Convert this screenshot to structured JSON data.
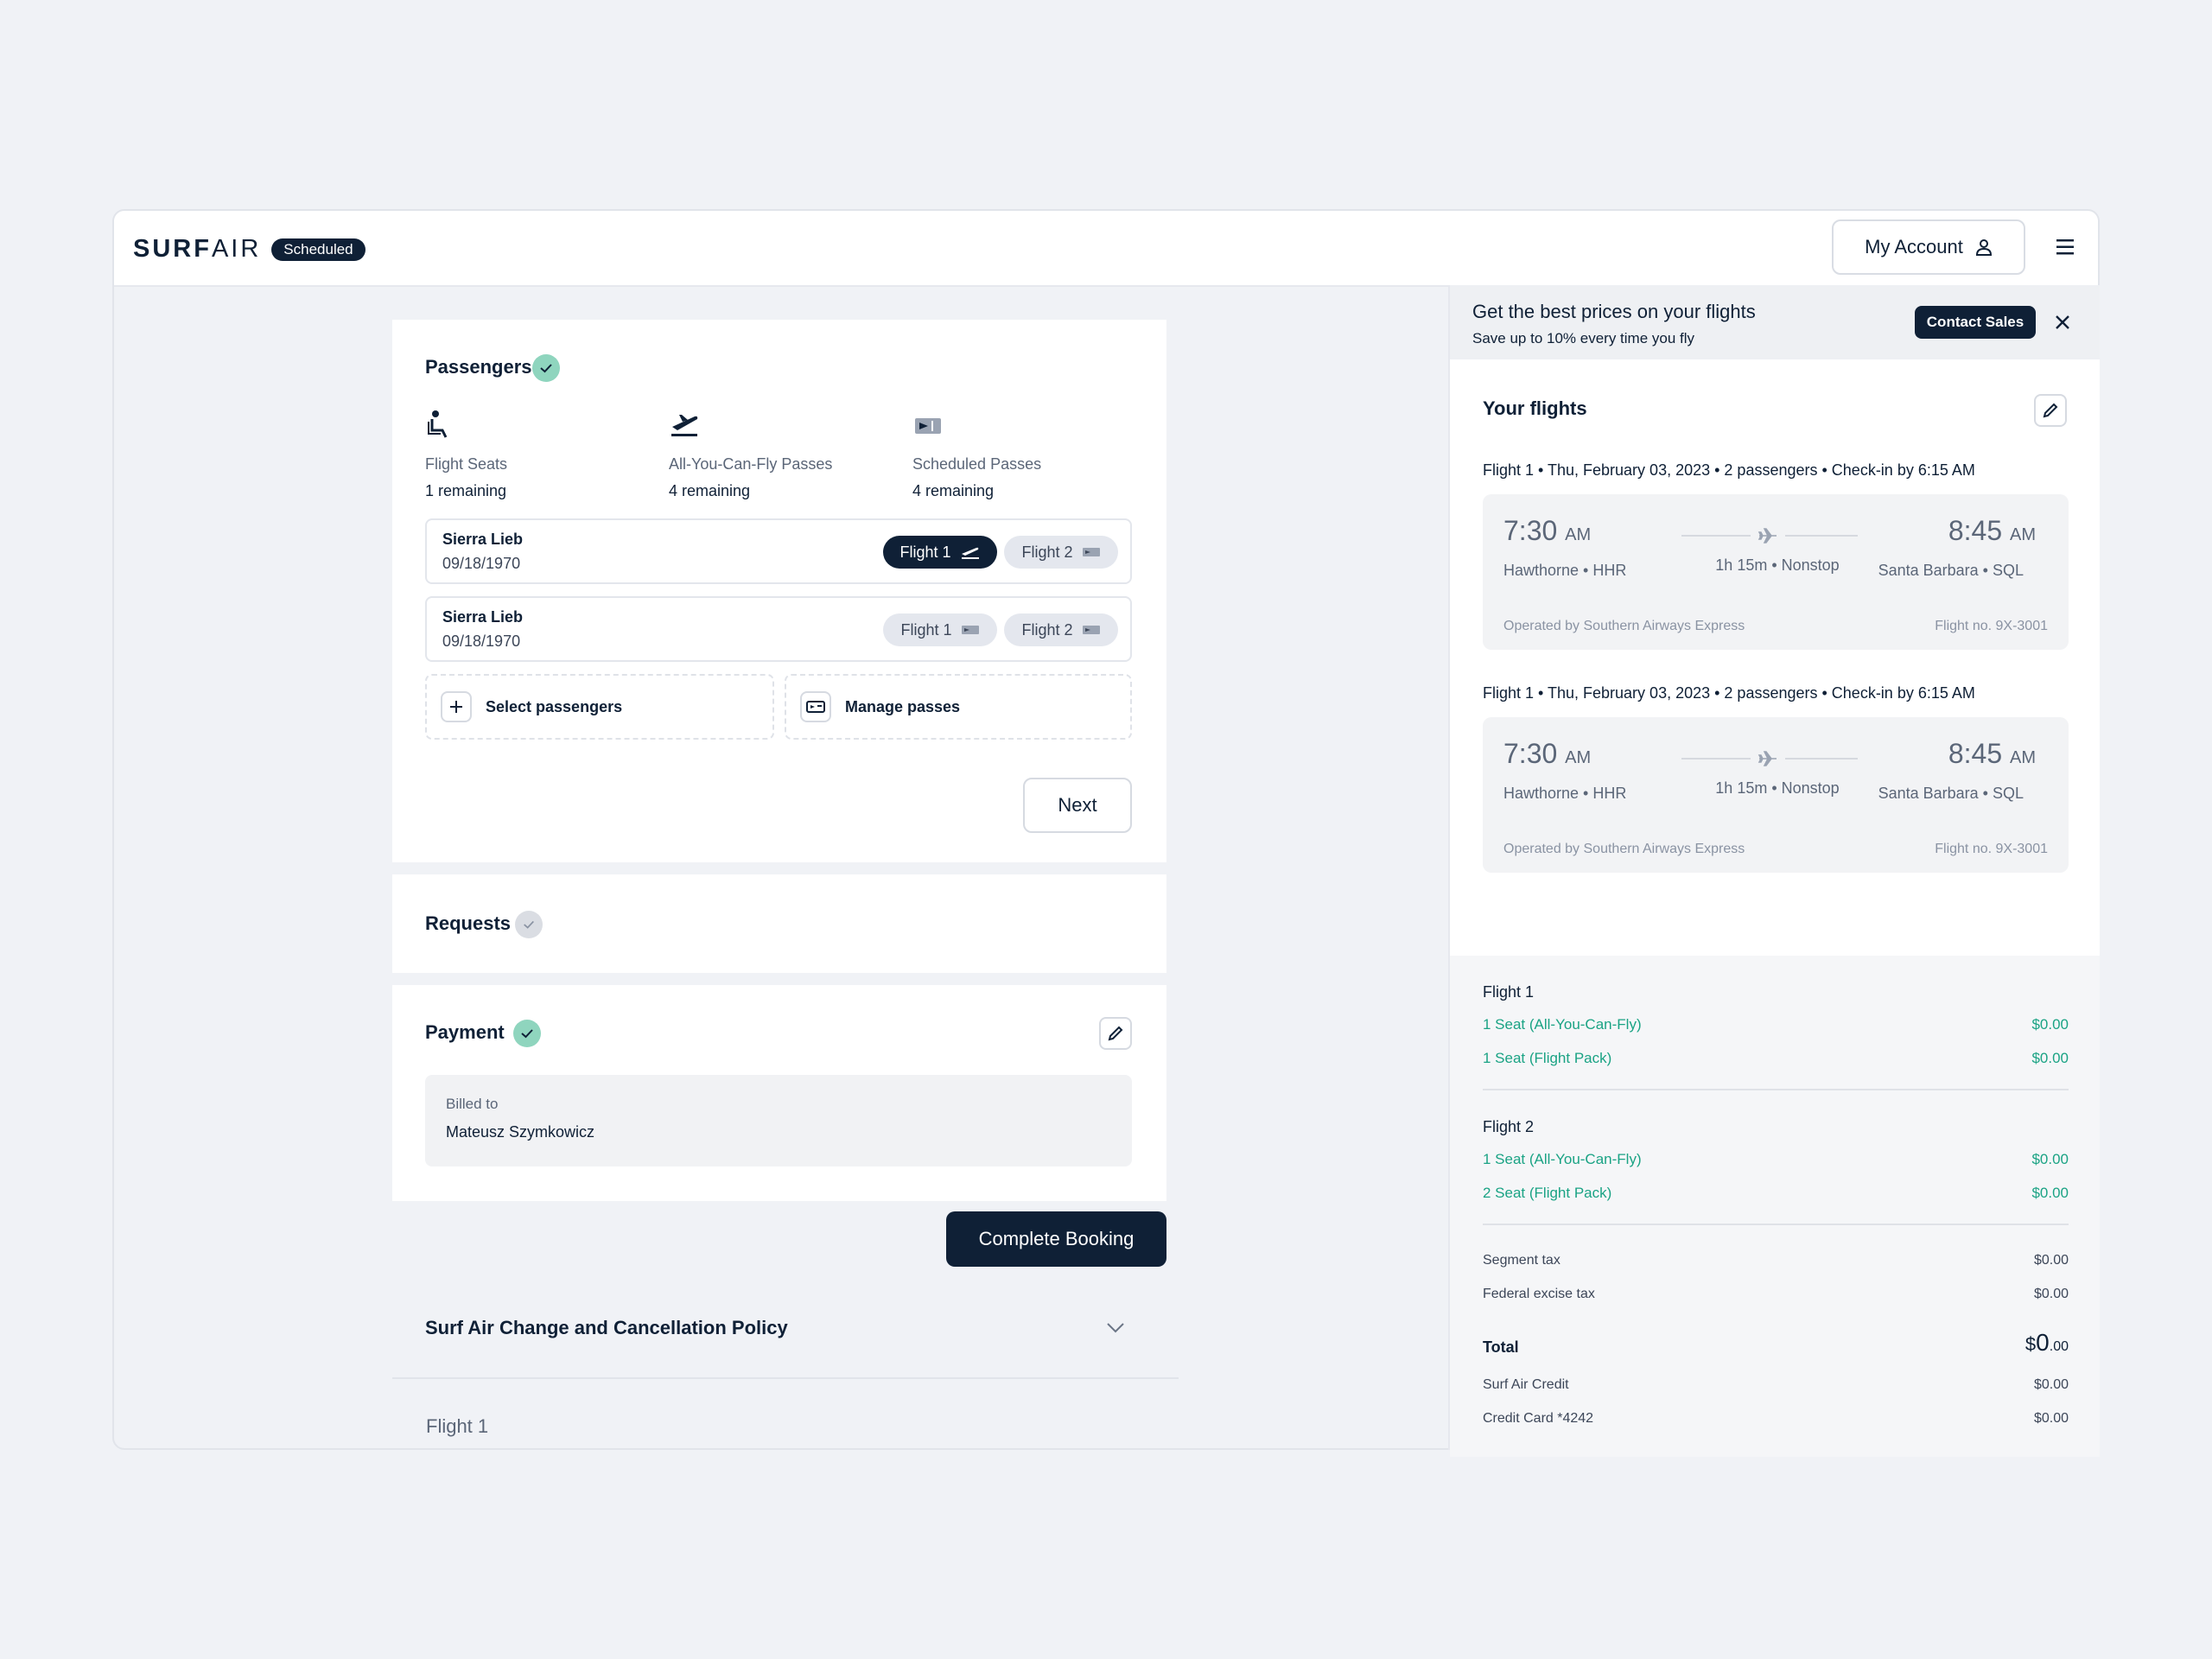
{
  "header": {
    "logo_bold": "SURF",
    "logo_light": "AIR",
    "badge": "Scheduled",
    "account_label": "My Account"
  },
  "passengers": {
    "title": "Passengers",
    "stats": [
      {
        "label": "Flight Seats",
        "value": "1 remaining",
        "icon": "seat-icon"
      },
      {
        "label": "All-You-Can-Fly Passes",
        "value": "4 remaining",
        "icon": "plane-takeoff-icon"
      },
      {
        "label": "Scheduled Passes",
        "value": "4 remaining",
        "icon": "ticket-icon"
      }
    ],
    "rows": [
      {
        "name": "Sierra Lieb",
        "dob": "09/18/1970",
        "pill1": "Flight 1",
        "pill2": "Flight 2"
      },
      {
        "name": "Sierra Lieb",
        "dob": "09/18/1970",
        "pill1": "Flight 1",
        "pill2": "Flight 2"
      }
    ],
    "select_label": "Select passengers",
    "manage_label": "Manage passes",
    "next_label": "Next"
  },
  "requests": {
    "title": "Requests"
  },
  "payment": {
    "title": "Payment",
    "billed_label": "Billed to",
    "billed_name": "Mateusz Szymkowicz"
  },
  "complete_label": "Complete Booking",
  "policy": {
    "title": "Surf Air Change and Cancellation Policy",
    "flight_label": "Flight 1"
  },
  "promo": {
    "title": "Get the best prices on your flights",
    "subtitle": "Save up to 10% every time you fly",
    "contact_label": "Contact Sales"
  },
  "your_flights": {
    "title": "Your flights",
    "flights": [
      {
        "meta": "Flight 1  •  Thu, February 03, 2023  •  2 passengers  •  Check-in by 6:15 AM",
        "dep_time": "7:30",
        "dep_ampm": "AM",
        "dep_city": "Hawthorne  •  HHR",
        "arr_time": "8:45",
        "arr_ampm": "AM",
        "arr_city": "Santa Barbara  •  SQL",
        "duration": "1h 15m  •  Nonstop",
        "operator": "Operated by Southern Airways Express",
        "flight_no": "Flight no.  9X-3001"
      },
      {
        "meta": "Flight 1  •  Thu, February 03, 2023  •  2 passengers  •  Check-in by 6:15 AM",
        "dep_time": "7:30",
        "dep_ampm": "AM",
        "dep_city": "Hawthorne  •  HHR",
        "arr_time": "8:45",
        "arr_ampm": "AM",
        "arr_city": "Santa Barbara  •  SQL",
        "duration": "1h 15m  •  Nonstop",
        "operator": "Operated by Southern Airways Express",
        "flight_no": "Flight no.  9X-3001"
      }
    ]
  },
  "summary": {
    "groups": [
      {
        "title": "Flight 1",
        "items": [
          {
            "label": "1 Seat (All-You-Can-Fly)",
            "amount": "$0.00"
          },
          {
            "label": "1 Seat (Flight Pack)",
            "amount": "$0.00"
          }
        ]
      },
      {
        "title": "Flight 2",
        "items": [
          {
            "label": "1 Seat (All-You-Can-Fly)",
            "amount": "$0.00"
          },
          {
            "label": "2 Seat (Flight Pack)",
            "amount": "$0.00"
          }
        ]
      }
    ],
    "taxes": [
      {
        "label": "Segment tax",
        "amount": "$0.00"
      },
      {
        "label": "Federal excise tax",
        "amount": "$0.00"
      }
    ],
    "total_label": "Total",
    "total_dollar": "$",
    "total_whole": "0",
    "total_cents": ".00",
    "credits": [
      {
        "label": "Surf Air Credit",
        "amount": "$0.00"
      },
      {
        "label": "Credit Card *4242",
        "amount": "$0.00"
      }
    ]
  },
  "colors": {
    "navy": "#0f2036",
    "green": "#1aa384",
    "check": "#8fd5be"
  }
}
